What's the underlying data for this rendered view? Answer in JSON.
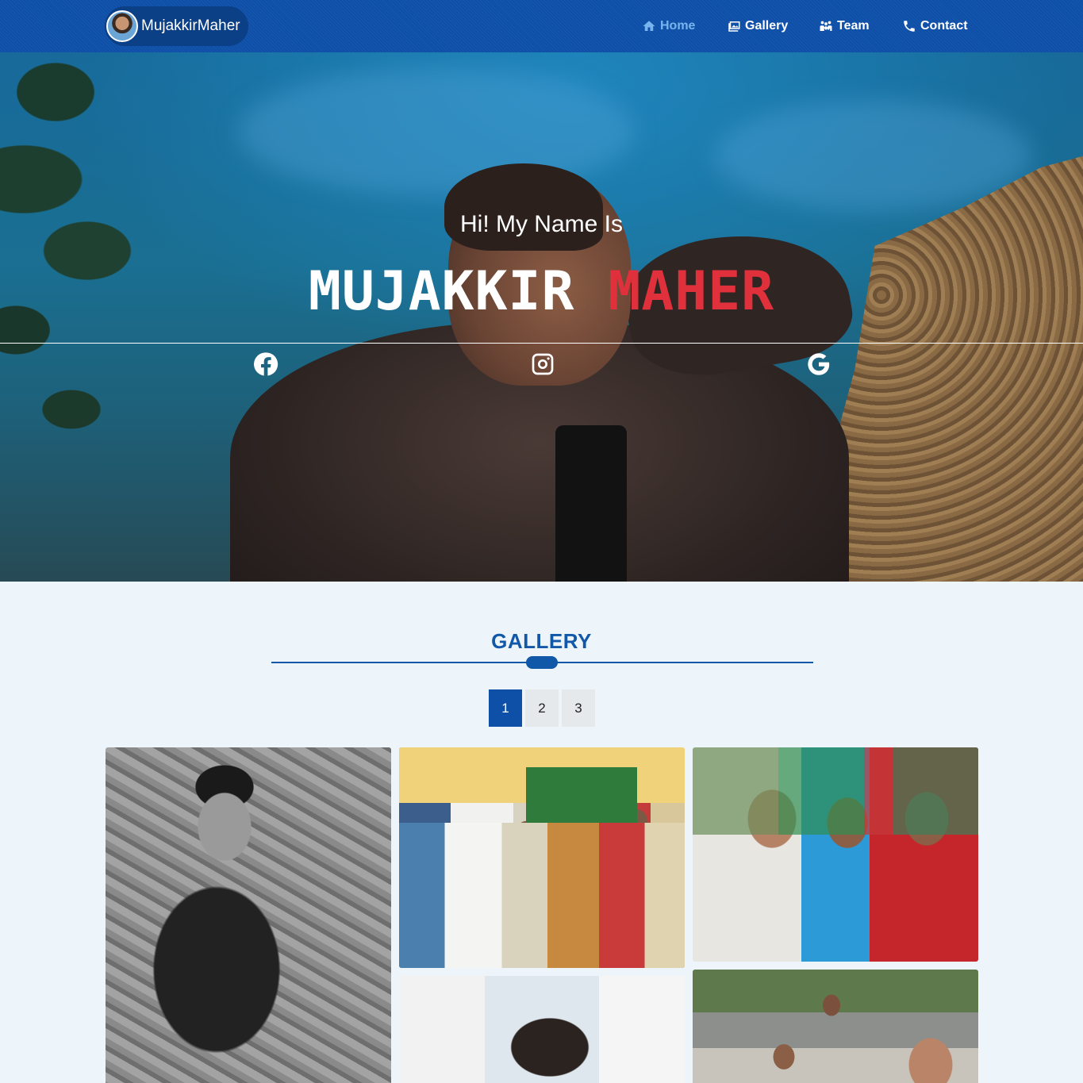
{
  "brand": {
    "name": "MujakkirMaher"
  },
  "nav": {
    "items": [
      {
        "label": "Home",
        "icon": "home-icon",
        "active": true
      },
      {
        "label": "Gallery",
        "icon": "images-icon",
        "active": false
      },
      {
        "label": "Team",
        "icon": "team-icon",
        "active": false
      },
      {
        "label": "Contact",
        "icon": "phone-icon",
        "active": false
      }
    ]
  },
  "hero": {
    "greeting": "Hi! My Name Is",
    "first_name": "MUJAKKIR",
    "last_name": "MAHER",
    "social": [
      "facebook-icon",
      "instagram-icon",
      "google-icon"
    ]
  },
  "gallery": {
    "title": "GALLERY",
    "pages": [
      "1",
      "2",
      "3"
    ],
    "active_page": "1"
  },
  "colors": {
    "navbar": "#0e4fa8",
    "accent": "#1258a8",
    "highlight": "#e0303c",
    "active_nav": "#78b4ee"
  }
}
